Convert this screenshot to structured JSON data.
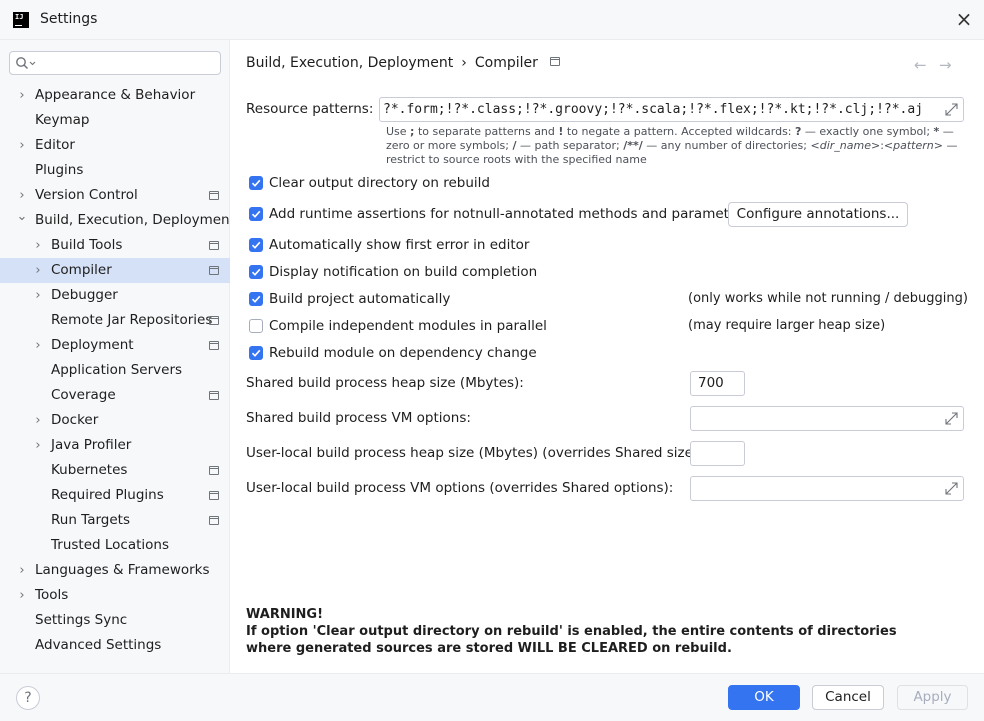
{
  "window": {
    "title": "Settings"
  },
  "search": {
    "placeholder": ""
  },
  "sidebar": {
    "items": [
      {
        "label": "Appearance & Behavior",
        "level": 0,
        "chevron": "right",
        "project": false,
        "selected": false
      },
      {
        "label": "Keymap",
        "level": 0,
        "chevron": "",
        "project": false,
        "selected": false
      },
      {
        "label": "Editor",
        "level": 0,
        "chevron": "right",
        "project": false,
        "selected": false
      },
      {
        "label": "Plugins",
        "level": 0,
        "chevron": "",
        "project": false,
        "selected": false
      },
      {
        "label": "Version Control",
        "level": 0,
        "chevron": "right",
        "project": true,
        "selected": false
      },
      {
        "label": "Build, Execution, Deployment",
        "level": 0,
        "chevron": "down",
        "project": false,
        "selected": false
      },
      {
        "label": "Build Tools",
        "level": 1,
        "chevron": "right",
        "project": true,
        "selected": false
      },
      {
        "label": "Compiler",
        "level": 1,
        "chevron": "right",
        "project": true,
        "selected": true
      },
      {
        "label": "Debugger",
        "level": 1,
        "chevron": "right",
        "project": false,
        "selected": false
      },
      {
        "label": "Remote Jar Repositories",
        "level": 1,
        "chevron": "",
        "project": true,
        "selected": false
      },
      {
        "label": "Deployment",
        "level": 1,
        "chevron": "right",
        "project": true,
        "selected": false
      },
      {
        "label": "Application Servers",
        "level": 1,
        "chevron": "",
        "project": false,
        "selected": false
      },
      {
        "label": "Coverage",
        "level": 1,
        "chevron": "",
        "project": true,
        "selected": false
      },
      {
        "label": "Docker",
        "level": 1,
        "chevron": "right",
        "project": false,
        "selected": false
      },
      {
        "label": "Java Profiler",
        "level": 1,
        "chevron": "right",
        "project": false,
        "selected": false
      },
      {
        "label": "Kubernetes",
        "level": 1,
        "chevron": "",
        "project": true,
        "selected": false
      },
      {
        "label": "Required Plugins",
        "level": 1,
        "chevron": "",
        "project": true,
        "selected": false
      },
      {
        "label": "Run Targets",
        "level": 1,
        "chevron": "",
        "project": true,
        "selected": false
      },
      {
        "label": "Trusted Locations",
        "level": 1,
        "chevron": "",
        "project": false,
        "selected": false
      },
      {
        "label": "Languages & Frameworks",
        "level": 0,
        "chevron": "right",
        "project": false,
        "selected": false
      },
      {
        "label": "Tools",
        "level": 0,
        "chevron": "right",
        "project": false,
        "selected": false
      },
      {
        "label": "Settings Sync",
        "level": 0,
        "chevron": "",
        "project": false,
        "selected": false
      },
      {
        "label": "Advanced Settings",
        "level": 0,
        "chevron": "",
        "project": false,
        "selected": false
      }
    ]
  },
  "breadcrumb": {
    "parent": "Build, Execution, Deployment",
    "separator": "›",
    "current": "Compiler"
  },
  "nav": {
    "back": "←",
    "forward": "→"
  },
  "resource_patterns": {
    "label": "Resource patterns:",
    "value": "?*.form;!?*.class;!?*.groovy;!?*.scala;!?*.flex;!?*.kt;!?*.clj;!?*.aj"
  },
  "hint": {
    "t1": "Use ",
    "b1": ";",
    "t2": " to separate patterns and ",
    "b2": "!",
    "t3": " to negate a pattern. Accepted wildcards: ",
    "b3": "?",
    "t4": " — exactly one symbol; ",
    "b4": "*",
    "t5": " — zero or more symbols; ",
    "b5": "/",
    "t6": " — path separator; ",
    "b6": "/**/",
    "t7": " — any number of directories; ",
    "i1": "<dir_name>",
    "t8": ":",
    "i2": "<pattern>",
    "t9": " — restrict to source roots with the specified name"
  },
  "options": {
    "clear_output": {
      "label": "Clear output directory on rebuild",
      "checked": true
    },
    "runtime_assertions": {
      "label": "Add runtime assertions for notnull-annotated methods and parameters",
      "checked": true
    },
    "configure_annotations": "Configure annotations...",
    "show_first_error": {
      "label": "Automatically show first error in editor",
      "checked": true
    },
    "display_notification": {
      "label": "Display notification on build completion",
      "checked": true
    },
    "build_automatically": {
      "label": "Build project automatically",
      "checked": true,
      "note": "(only works while not running / debugging)"
    },
    "compile_parallel": {
      "label": "Compile independent modules in parallel",
      "checked": false,
      "note": "(may require larger heap size)"
    },
    "rebuild_on_dependency": {
      "label": "Rebuild module on dependency change",
      "checked": true
    }
  },
  "fields": {
    "shared_heap_label": "Shared build process heap size (Mbytes):",
    "shared_heap_value": "700",
    "shared_vm_label": "Shared build process VM options:",
    "shared_vm_value": "",
    "user_heap_label": "User-local build process heap size (Mbytes) (overrides Shared size):",
    "user_heap_value": "",
    "user_vm_label": "User-local build process VM options (overrides Shared options):",
    "user_vm_value": ""
  },
  "warning": {
    "title": "WARNING!",
    "text": "If option 'Clear output directory on rebuild' is enabled, the entire contents of directories where generated sources are stored WILL BE CLEARED on rebuild."
  },
  "footer": {
    "help": "?",
    "ok": "OK",
    "cancel": "Cancel",
    "apply": "Apply"
  },
  "colors": {
    "accent": "#3574f0",
    "selection": "#d5e1f7",
    "panel": "#f7f8fa"
  }
}
